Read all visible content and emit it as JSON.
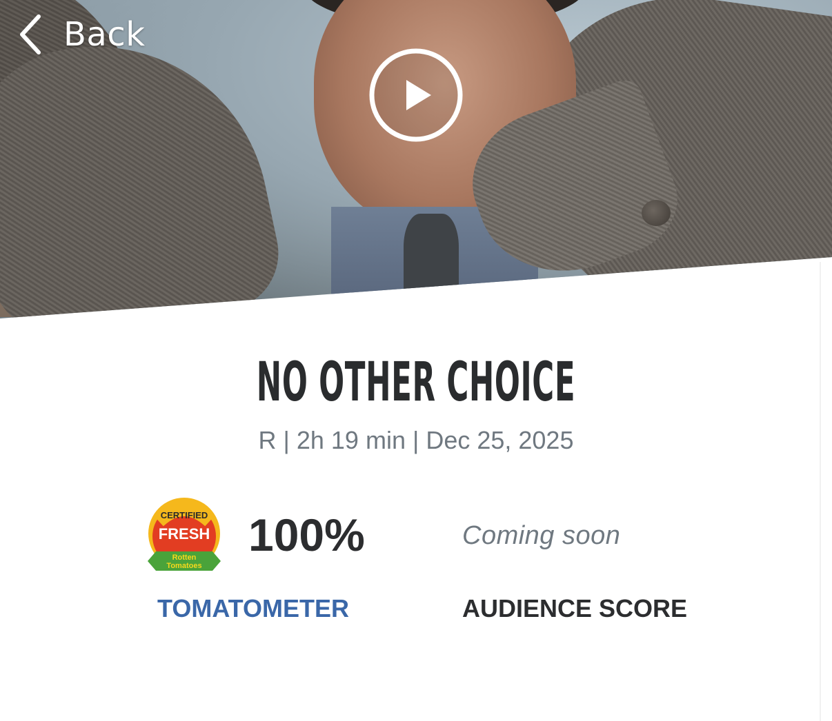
{
  "nav": {
    "back_label": "Back"
  },
  "hero": {
    "play_label": "Play trailer"
  },
  "movie": {
    "title": "NO OTHER CHOICE",
    "meta": "R | 2h 19 min | Dec 25, 2025"
  },
  "scores": {
    "tomatometer": {
      "value": "100%",
      "label": "TOMATOMETER",
      "badge": {
        "top": "CERTIFIED",
        "middle": "FRESH",
        "bottom1": "Rotten",
        "bottom2": "Tomatoes"
      }
    },
    "audience": {
      "value": "Coming soon",
      "label": "AUDIENCE SCORE"
    }
  },
  "colors": {
    "tomatometer_label": "#3a67a8",
    "title": "#2a2c2e",
    "meta": "#6f7880"
  }
}
